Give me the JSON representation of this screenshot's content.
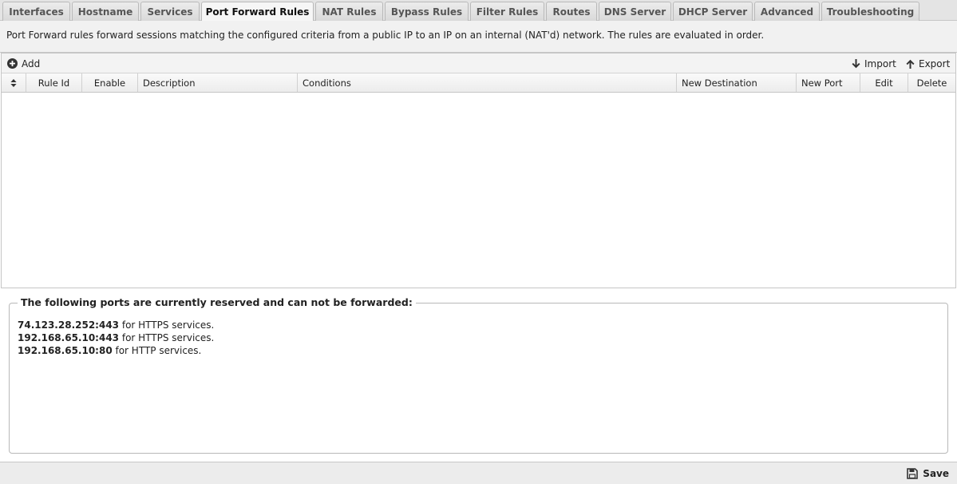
{
  "tabs": [
    {
      "label": "Interfaces",
      "active": false
    },
    {
      "label": "Hostname",
      "active": false
    },
    {
      "label": "Services",
      "active": false
    },
    {
      "label": "Port Forward Rules",
      "active": true
    },
    {
      "label": "NAT Rules",
      "active": false
    },
    {
      "label": "Bypass Rules",
      "active": false
    },
    {
      "label": "Filter Rules",
      "active": false
    },
    {
      "label": "Routes",
      "active": false
    },
    {
      "label": "DNS Server",
      "active": false
    },
    {
      "label": "DHCP Server",
      "active": false
    },
    {
      "label": "Advanced",
      "active": false
    },
    {
      "label": "Troubleshooting",
      "active": false
    }
  ],
  "description": "Port Forward rules forward sessions matching the configured criteria from a public IP to an IP on an internal (NAT'd) network. The rules are evaluated in order.",
  "toolbar": {
    "add_label": "Add",
    "import_label": "Import",
    "export_label": "Export"
  },
  "grid": {
    "columns": [
      "Rule Id",
      "Enable",
      "Description",
      "Conditions",
      "New Destination",
      "New Port",
      "Edit",
      "Delete"
    ],
    "rows": []
  },
  "reserved": {
    "legend": "The following ports are currently reserved and can not be forwarded:",
    "items": [
      {
        "address": "74.123.28.252:443",
        "suffix": " for HTTPS services."
      },
      {
        "address": "192.168.65.10:443",
        "suffix": " for HTTPS services."
      },
      {
        "address": "192.168.65.10:80",
        "suffix": " for HTTP services."
      }
    ]
  },
  "footer": {
    "save_label": "Save"
  }
}
